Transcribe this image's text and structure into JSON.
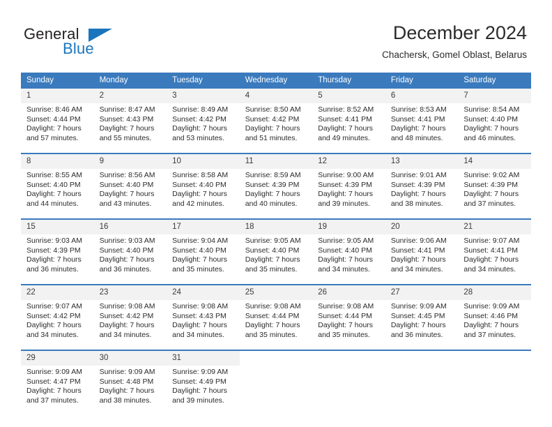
{
  "brand": {
    "name_part1": "General",
    "name_part2": "Blue",
    "accent_color": "#1b75bc"
  },
  "header": {
    "title": "December 2024",
    "subtitle": "Chachersk, Gomel Oblast, Belarus"
  },
  "calendar": {
    "header_bg": "#3a7abd",
    "daynum_bg": "#f2f2f2",
    "weekdays": [
      "Sunday",
      "Monday",
      "Tuesday",
      "Wednesday",
      "Thursday",
      "Friday",
      "Saturday"
    ],
    "weeks": [
      [
        {
          "day": "1",
          "sunrise": "Sunrise: 8:46 AM",
          "sunset": "Sunset: 4:44 PM",
          "daylight1": "Daylight: 7 hours",
          "daylight2": "and 57 minutes."
        },
        {
          "day": "2",
          "sunrise": "Sunrise: 8:47 AM",
          "sunset": "Sunset: 4:43 PM",
          "daylight1": "Daylight: 7 hours",
          "daylight2": "and 55 minutes."
        },
        {
          "day": "3",
          "sunrise": "Sunrise: 8:49 AM",
          "sunset": "Sunset: 4:42 PM",
          "daylight1": "Daylight: 7 hours",
          "daylight2": "and 53 minutes."
        },
        {
          "day": "4",
          "sunrise": "Sunrise: 8:50 AM",
          "sunset": "Sunset: 4:42 PM",
          "daylight1": "Daylight: 7 hours",
          "daylight2": "and 51 minutes."
        },
        {
          "day": "5",
          "sunrise": "Sunrise: 8:52 AM",
          "sunset": "Sunset: 4:41 PM",
          "daylight1": "Daylight: 7 hours",
          "daylight2": "and 49 minutes."
        },
        {
          "day": "6",
          "sunrise": "Sunrise: 8:53 AM",
          "sunset": "Sunset: 4:41 PM",
          "daylight1": "Daylight: 7 hours",
          "daylight2": "and 48 minutes."
        },
        {
          "day": "7",
          "sunrise": "Sunrise: 8:54 AM",
          "sunset": "Sunset: 4:40 PM",
          "daylight1": "Daylight: 7 hours",
          "daylight2": "and 46 minutes."
        }
      ],
      [
        {
          "day": "8",
          "sunrise": "Sunrise: 8:55 AM",
          "sunset": "Sunset: 4:40 PM",
          "daylight1": "Daylight: 7 hours",
          "daylight2": "and 44 minutes."
        },
        {
          "day": "9",
          "sunrise": "Sunrise: 8:56 AM",
          "sunset": "Sunset: 4:40 PM",
          "daylight1": "Daylight: 7 hours",
          "daylight2": "and 43 minutes."
        },
        {
          "day": "10",
          "sunrise": "Sunrise: 8:58 AM",
          "sunset": "Sunset: 4:40 PM",
          "daylight1": "Daylight: 7 hours",
          "daylight2": "and 42 minutes."
        },
        {
          "day": "11",
          "sunrise": "Sunrise: 8:59 AM",
          "sunset": "Sunset: 4:39 PM",
          "daylight1": "Daylight: 7 hours",
          "daylight2": "and 40 minutes."
        },
        {
          "day": "12",
          "sunrise": "Sunrise: 9:00 AM",
          "sunset": "Sunset: 4:39 PM",
          "daylight1": "Daylight: 7 hours",
          "daylight2": "and 39 minutes."
        },
        {
          "day": "13",
          "sunrise": "Sunrise: 9:01 AM",
          "sunset": "Sunset: 4:39 PM",
          "daylight1": "Daylight: 7 hours",
          "daylight2": "and 38 minutes."
        },
        {
          "day": "14",
          "sunrise": "Sunrise: 9:02 AM",
          "sunset": "Sunset: 4:39 PM",
          "daylight1": "Daylight: 7 hours",
          "daylight2": "and 37 minutes."
        }
      ],
      [
        {
          "day": "15",
          "sunrise": "Sunrise: 9:03 AM",
          "sunset": "Sunset: 4:39 PM",
          "daylight1": "Daylight: 7 hours",
          "daylight2": "and 36 minutes."
        },
        {
          "day": "16",
          "sunrise": "Sunrise: 9:03 AM",
          "sunset": "Sunset: 4:40 PM",
          "daylight1": "Daylight: 7 hours",
          "daylight2": "and 36 minutes."
        },
        {
          "day": "17",
          "sunrise": "Sunrise: 9:04 AM",
          "sunset": "Sunset: 4:40 PM",
          "daylight1": "Daylight: 7 hours",
          "daylight2": "and 35 minutes."
        },
        {
          "day": "18",
          "sunrise": "Sunrise: 9:05 AM",
          "sunset": "Sunset: 4:40 PM",
          "daylight1": "Daylight: 7 hours",
          "daylight2": "and 35 minutes."
        },
        {
          "day": "19",
          "sunrise": "Sunrise: 9:05 AM",
          "sunset": "Sunset: 4:40 PM",
          "daylight1": "Daylight: 7 hours",
          "daylight2": "and 34 minutes."
        },
        {
          "day": "20",
          "sunrise": "Sunrise: 9:06 AM",
          "sunset": "Sunset: 4:41 PM",
          "daylight1": "Daylight: 7 hours",
          "daylight2": "and 34 minutes."
        },
        {
          "day": "21",
          "sunrise": "Sunrise: 9:07 AM",
          "sunset": "Sunset: 4:41 PM",
          "daylight1": "Daylight: 7 hours",
          "daylight2": "and 34 minutes."
        }
      ],
      [
        {
          "day": "22",
          "sunrise": "Sunrise: 9:07 AM",
          "sunset": "Sunset: 4:42 PM",
          "daylight1": "Daylight: 7 hours",
          "daylight2": "and 34 minutes."
        },
        {
          "day": "23",
          "sunrise": "Sunrise: 9:08 AM",
          "sunset": "Sunset: 4:42 PM",
          "daylight1": "Daylight: 7 hours",
          "daylight2": "and 34 minutes."
        },
        {
          "day": "24",
          "sunrise": "Sunrise: 9:08 AM",
          "sunset": "Sunset: 4:43 PM",
          "daylight1": "Daylight: 7 hours",
          "daylight2": "and 34 minutes."
        },
        {
          "day": "25",
          "sunrise": "Sunrise: 9:08 AM",
          "sunset": "Sunset: 4:44 PM",
          "daylight1": "Daylight: 7 hours",
          "daylight2": "and 35 minutes."
        },
        {
          "day": "26",
          "sunrise": "Sunrise: 9:08 AM",
          "sunset": "Sunset: 4:44 PM",
          "daylight1": "Daylight: 7 hours",
          "daylight2": "and 35 minutes."
        },
        {
          "day": "27",
          "sunrise": "Sunrise: 9:09 AM",
          "sunset": "Sunset: 4:45 PM",
          "daylight1": "Daylight: 7 hours",
          "daylight2": "and 36 minutes."
        },
        {
          "day": "28",
          "sunrise": "Sunrise: 9:09 AM",
          "sunset": "Sunset: 4:46 PM",
          "daylight1": "Daylight: 7 hours",
          "daylight2": "and 37 minutes."
        }
      ],
      [
        {
          "day": "29",
          "sunrise": "Sunrise: 9:09 AM",
          "sunset": "Sunset: 4:47 PM",
          "daylight1": "Daylight: 7 hours",
          "daylight2": "and 37 minutes."
        },
        {
          "day": "30",
          "sunrise": "Sunrise: 9:09 AM",
          "sunset": "Sunset: 4:48 PM",
          "daylight1": "Daylight: 7 hours",
          "daylight2": "and 38 minutes."
        },
        {
          "day": "31",
          "sunrise": "Sunrise: 9:09 AM",
          "sunset": "Sunset: 4:49 PM",
          "daylight1": "Daylight: 7 hours",
          "daylight2": "and 39 minutes."
        },
        null,
        null,
        null,
        null
      ]
    ]
  }
}
